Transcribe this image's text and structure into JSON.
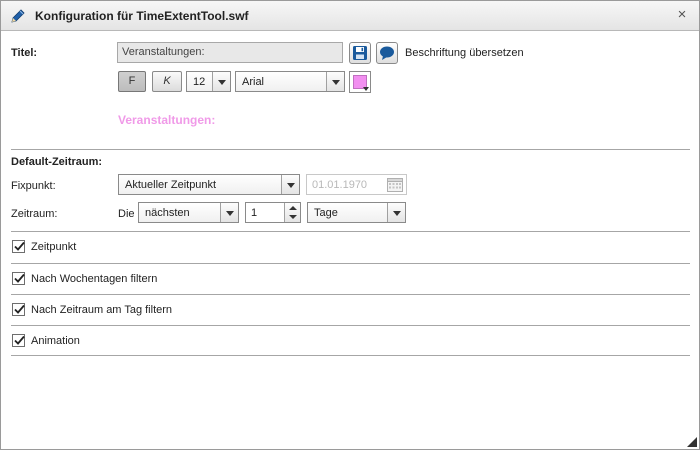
{
  "window": {
    "title": "Konfiguration für TimeExtentTool.swf",
    "close_glyph": "×",
    "icon": "pencil-icon"
  },
  "title_section": {
    "label": "Titel:",
    "value": "Veranstaltungen:",
    "save_icon": "floppy-disk-icon",
    "translate_icon": "speech-bubble-icon",
    "translate_label": "Beschriftung übersetzen",
    "bold_label": "F",
    "italic_label": "K",
    "font_size": "12",
    "font_family": "Arial",
    "text_color": "#f28ff0",
    "preview_text": "Veranstaltungen:"
  },
  "default_range": {
    "heading": "Default-Zeitraum:",
    "fixpunkt_label": "Fixpunkt:",
    "fixpunkt_value": "Aktueller Zeitpunkt",
    "date_value": "01.01.1970",
    "calendar_icon": "calendar-icon",
    "zeitraum_label": "Zeitraum:",
    "die_label": "Die",
    "direction_value": "nächsten",
    "amount_value": "1",
    "unit_value": "Tage"
  },
  "options": [
    {
      "label": "Zeitpunkt",
      "checked": true
    },
    {
      "label": "Nach Wochentagen filtern",
      "checked": true
    },
    {
      "label": "Nach Zeitraum am Tag filtern",
      "checked": true
    },
    {
      "label": "Animation",
      "checked": true
    }
  ],
  "colors": {
    "preview_text": "#f09ae8",
    "save_icon": "#1a5a9c",
    "translate_icon": "#1a5a9c"
  }
}
